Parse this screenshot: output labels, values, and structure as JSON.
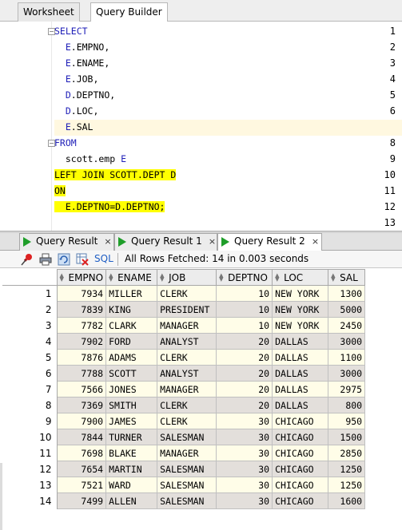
{
  "top_tabs": {
    "worksheet": "Worksheet",
    "query_builder": "Query Builder"
  },
  "editor": {
    "lines": [
      {
        "num": "1",
        "parts": [
          {
            "t": "SELECT",
            "c": "kw"
          }
        ]
      },
      {
        "num": "2",
        "parts": [
          {
            "t": "  E",
            "c": "alias"
          },
          {
            "t": ".EMPNO,",
            "c": "plain"
          }
        ]
      },
      {
        "num": "3",
        "parts": [
          {
            "t": "  E",
            "c": "alias"
          },
          {
            "t": ".ENAME,",
            "c": "plain"
          }
        ]
      },
      {
        "num": "4",
        "parts": [
          {
            "t": "  E",
            "c": "alias"
          },
          {
            "t": ".JOB,",
            "c": "plain"
          }
        ]
      },
      {
        "num": "5",
        "parts": [
          {
            "t": "  D",
            "c": "alias"
          },
          {
            "t": ".DEPTNO,",
            "c": "plain"
          }
        ]
      },
      {
        "num": "6",
        "parts": [
          {
            "t": "  D",
            "c": "alias"
          },
          {
            "t": ".LOC,",
            "c": "plain"
          }
        ]
      },
      {
        "num": "7",
        "parts": [
          {
            "t": "  E",
            "c": "alias"
          },
          {
            "t": ".SAL",
            "c": "plain"
          }
        ]
      },
      {
        "num": "8",
        "parts": [
          {
            "t": "FROM",
            "c": "kw"
          }
        ]
      },
      {
        "num": "9",
        "parts": [
          {
            "t": "  scott.emp ",
            "c": "plain"
          },
          {
            "t": "E",
            "c": "alias"
          }
        ]
      },
      {
        "num": "10",
        "parts": [
          {
            "t": "LEFT JOIN SCOTT.DEPT D",
            "c": "plain hl"
          }
        ]
      },
      {
        "num": "11",
        "parts": [
          {
            "t": "ON",
            "c": "plain hl"
          }
        ]
      },
      {
        "num": "12",
        "parts": [
          {
            "t": "  E.DEPTNO=D.DEPTNO;",
            "c": "plain hl"
          }
        ]
      },
      {
        "num": "13",
        "parts": []
      }
    ]
  },
  "result_tabs": [
    {
      "label": "Query Result",
      "close": "×"
    },
    {
      "label": "Query Result 1",
      "close": "×"
    },
    {
      "label": "Query Result 2",
      "close": "×"
    }
  ],
  "toolbar": {
    "sql_label": "SQL",
    "status": "All Rows Fetched: 14 in 0.003 seconds"
  },
  "grid": {
    "columns": [
      "EMPNO",
      "ENAME",
      "JOB",
      "DEPTNO",
      "LOC",
      "SAL"
    ],
    "rows": [
      [
        "1",
        "7934",
        "MILLER",
        "CLERK",
        "10",
        "NEW YORK",
        "1300"
      ],
      [
        "2",
        "7839",
        "KING",
        "PRESIDENT",
        "10",
        "NEW YORK",
        "5000"
      ],
      [
        "3",
        "7782",
        "CLARK",
        "MANAGER",
        "10",
        "NEW YORK",
        "2450"
      ],
      [
        "4",
        "7902",
        "FORD",
        "ANALYST",
        "20",
        "DALLAS",
        "3000"
      ],
      [
        "5",
        "7876",
        "ADAMS",
        "CLERK",
        "20",
        "DALLAS",
        "1100"
      ],
      [
        "6",
        "7788",
        "SCOTT",
        "ANALYST",
        "20",
        "DALLAS",
        "3000"
      ],
      [
        "7",
        "7566",
        "JONES",
        "MANAGER",
        "20",
        "DALLAS",
        "2975"
      ],
      [
        "8",
        "7369",
        "SMITH",
        "CLERK",
        "20",
        "DALLAS",
        "800"
      ],
      [
        "9",
        "7900",
        "JAMES",
        "CLERK",
        "30",
        "CHICAGO",
        "950"
      ],
      [
        "10",
        "7844",
        "TURNER",
        "SALESMAN",
        "30",
        "CHICAGO",
        "1500"
      ],
      [
        "11",
        "7698",
        "BLAKE",
        "MANAGER",
        "30",
        "CHICAGO",
        "2850"
      ],
      [
        "12",
        "7654",
        "MARTIN",
        "SALESMAN",
        "30",
        "CHICAGO",
        "1250"
      ],
      [
        "13",
        "7521",
        "WARD",
        "SALESMAN",
        "30",
        "CHICAGO",
        "1250"
      ],
      [
        "14",
        "7499",
        "ALLEN",
        "SALESMAN",
        "30",
        "CHICAGO",
        "1600"
      ]
    ]
  },
  "colors": {
    "keyword": "#1f1fb8",
    "highlight": "#ffff00",
    "run_green": "#1f9e2a",
    "row_odd": "#fffde8",
    "row_even": "#e3dfdb"
  }
}
